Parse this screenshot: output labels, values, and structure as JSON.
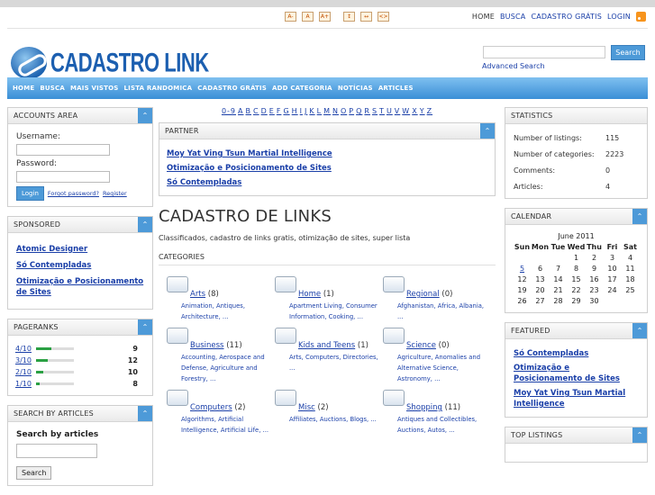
{
  "font_controls": [
    "A-",
    "A",
    "A+",
    "↕",
    "↔",
    "<>"
  ],
  "topnav": {
    "home": "HOME",
    "busca": "BUSCA",
    "cadastro": "CADASTRO GRÁTIS",
    "login": "LOGIN"
  },
  "brand": "CADASTRO LINK",
  "search": {
    "button": "Search",
    "advanced": "Advanced Search",
    "value": ""
  },
  "mainnav": [
    "HOME",
    "BUSCA",
    "MAIS VISTOS",
    "LISTA RANDOMICA",
    "CADASTRO GRÁTIS",
    "ADD CATEGORIA",
    "NOTÍCIAS",
    "ARTICLES"
  ],
  "accounts": {
    "title": "ACCOUNTS AREA",
    "username_label": "Username:",
    "password_label": "Password:",
    "login": "Login",
    "forgot": "Forgot password?",
    "register": "Register"
  },
  "sponsored": {
    "title": "SPONSORED",
    "links": [
      "Atomic Designer",
      "Só Contempladas",
      "Otimização e Posicionamento de Sites"
    ]
  },
  "pageranks": {
    "title": "PAGERANKS",
    "rows": [
      {
        "label": "4/10",
        "count": "9",
        "level": 0.4
      },
      {
        "label": "3/10",
        "count": "12",
        "level": 0.3
      },
      {
        "label": "2/10",
        "count": "10",
        "level": 0.2
      },
      {
        "label": "1/10",
        "count": "8",
        "level": 0.1
      }
    ]
  },
  "search_articles": {
    "title": "SEARCH BY ARTICLES",
    "heading": "Search by articles",
    "button": "Search"
  },
  "alphabet": [
    "0-9",
    "A",
    "B",
    "C",
    "D",
    "E",
    "F",
    "G",
    "H",
    "I",
    "J",
    "K",
    "L",
    "M",
    "N",
    "O",
    "P",
    "Q",
    "R",
    "S",
    "T",
    "U",
    "V",
    "W",
    "X",
    "Y",
    "Z"
  ],
  "partner": {
    "title": "PARTNER",
    "links": [
      "Moy Yat Ving Tsun Martial Intelligence",
      "Otimização e Posicionamento de Sites",
      "Só Contempladas"
    ]
  },
  "main": {
    "title": "CADASTRO DE LINKS",
    "description": "Classificados, cadastro de links gratis, otimização de sites, super lista",
    "categories_label": "CATEGORIES"
  },
  "categories": [
    {
      "name": "Arts",
      "count": "(8)",
      "subs": "Animation, Antiques, Architecture, ..."
    },
    {
      "name": "Home",
      "count": "(1)",
      "subs": "Apartment Living, Consumer Information, Cooking, ..."
    },
    {
      "name": "Regional",
      "count": "(0)",
      "subs": "Afghanistan, Africa, Albania, ..."
    },
    {
      "name": "Business",
      "count": "(11)",
      "subs": "Accounting, Aerospace and Defense, Agriculture and Forestry, ..."
    },
    {
      "name": "Kids and Teens",
      "count": "(1)",
      "subs": "Arts, Computers, Directories, ..."
    },
    {
      "name": "Science",
      "count": "(0)",
      "subs": "Agriculture, Anomalies and Alternative Science, Astronomy, ..."
    },
    {
      "name": "Computers",
      "count": "(2)",
      "subs": "Algorithms, Artificial Intelligence, Artificial Life, ..."
    },
    {
      "name": "Misc",
      "count": "(2)",
      "subs": "Affiliates, Auctions, Blogs, ..."
    },
    {
      "name": "Shopping",
      "count": "(11)",
      "subs": "Antiques and Collectibles, Auctions, Autos, ..."
    }
  ],
  "statistics": {
    "title": "STATISTICS",
    "rows": [
      {
        "k": "Number of listings:",
        "v": "115"
      },
      {
        "k": "Number of categories:",
        "v": "2223"
      },
      {
        "k": "Comments:",
        "v": "0"
      },
      {
        "k": "Articles:",
        "v": "4"
      }
    ]
  },
  "calendar": {
    "title": "CALENDAR",
    "month": "June 2011",
    "days": [
      "Sun",
      "Mon",
      "Tue",
      "Wed",
      "Thu",
      "Fri",
      "Sat"
    ],
    "cells": [
      "",
      "",
      "",
      "1",
      "2",
      "3",
      "4",
      "5",
      "6",
      "7",
      "8",
      "9",
      "10",
      "11",
      "12",
      "13",
      "14",
      "15",
      "16",
      "17",
      "18",
      "19",
      "20",
      "21",
      "22",
      "23",
      "24",
      "25",
      "26",
      "27",
      "28",
      "29",
      "30",
      "",
      ""
    ],
    "linked": [
      "5"
    ]
  },
  "featured": {
    "title": "FEATURED",
    "links": [
      "Só Contempladas",
      "Otimização e Posicionamento de Sites",
      "Moy Yat Ving Tsun Martial Intelligence"
    ]
  },
  "top_listings": {
    "title": "TOP LISTINGS"
  },
  "colors": {
    "accent": "#4d9ad8",
    "nav": "#3a8fd6",
    "link": "#1a3fa8"
  }
}
